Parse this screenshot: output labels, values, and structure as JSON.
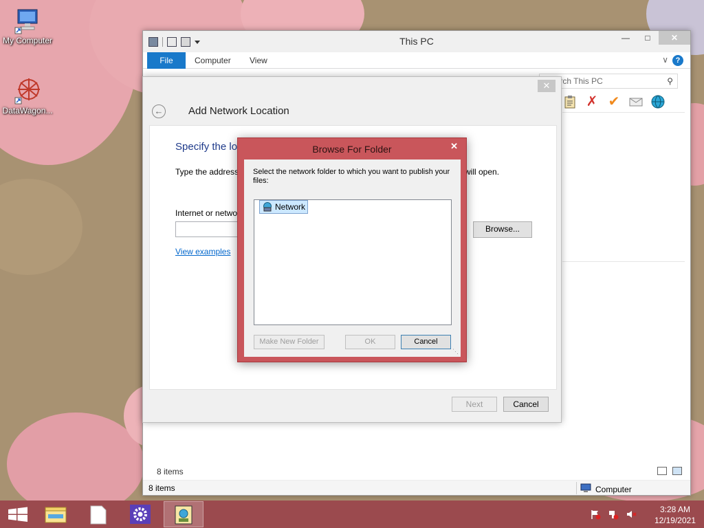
{
  "desktop": {
    "icons": [
      {
        "label": "My Computer"
      },
      {
        "label": "DataWagon..."
      }
    ]
  },
  "explorer": {
    "title": "This PC",
    "ribbon_tabs": [
      "File",
      "Computer",
      "View"
    ],
    "search_placeholder": "Search This PC",
    "items_count_inner": "8 items",
    "status_items": "8 items",
    "status_location": "Computer",
    "help_label": "?"
  },
  "wizard": {
    "title": "Add Network Location",
    "heading": "Specify the lo",
    "instruction": "Type the address",
    "instruction_tail": "will open.",
    "field_label": "Internet or netwo",
    "address_value": "",
    "browse_label": "Browse...",
    "examples_link": "View examples",
    "next_label": "Next",
    "cancel_label": "Cancel"
  },
  "browse_dialog": {
    "title": "Browse For Folder",
    "description": "Select the network folder to which you want to publish your files:",
    "tree_items": [
      "Network"
    ],
    "make_new_folder_label": "Make New Folder",
    "ok_label": "OK",
    "cancel_label": "Cancel"
  },
  "taskbar": {
    "time": "3:28 AM",
    "date": "12/19/2021"
  },
  "colors": {
    "accent_blue": "#1979ca",
    "dialog_frame": "#c9565b",
    "taskbar": "#9b4a4e",
    "link": "#0066cc"
  }
}
